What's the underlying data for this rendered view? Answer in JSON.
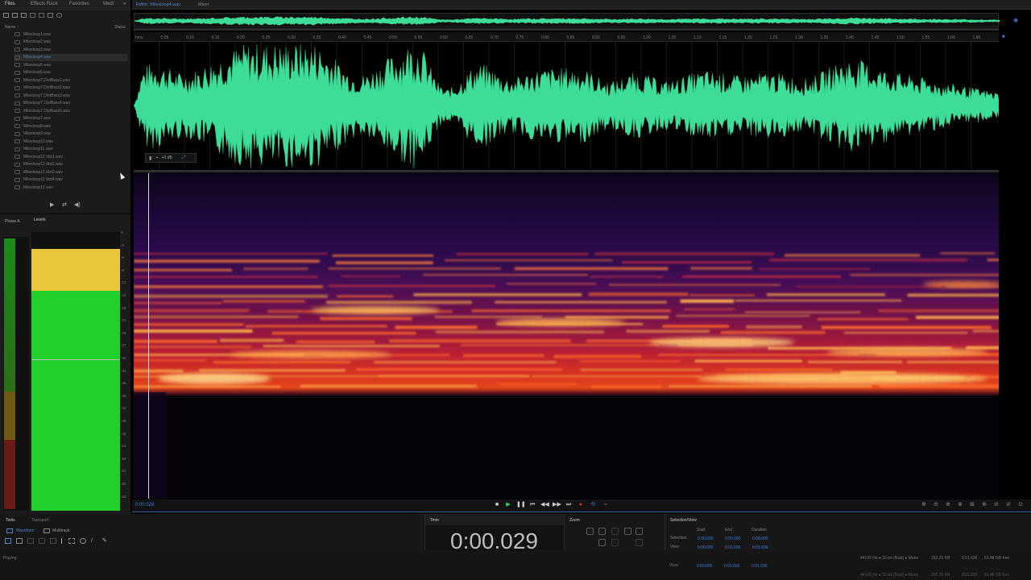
{
  "left_tabs": [
    "Files",
    "Effects Rack",
    "Favorites",
    "Medi"
  ],
  "files_header": {
    "name": "Name ↑",
    "status": "Status"
  },
  "files": [
    "Milesloop1.wav",
    "Milesloop2.wav",
    "Milesloop3.wav",
    "Milesloop4.wav",
    "Milesloop5.wav",
    "Milesloop6.wav",
    "Milesloop7 DistBass1.wav",
    "Milesloop7 DistBass2.wav",
    "Milesloop7 DistBass3.wav",
    "Milesloop7 DistBass4.wav",
    "Milesloop7 DistBass5.wav",
    "Milesloop7.wav",
    "Milesloop8.wav",
    "Milesloop9.wav",
    "Milesloop10.wav",
    "Milesloop11.wav",
    "Milesloop12 dist1.wav",
    "Milesloop12 dist2.wav",
    "Milesloop12 dist3.wav",
    "Milesloop12 dist4.wav",
    "Milesloop12.wav"
  ],
  "selected_file_index": 3,
  "meter_tabs": {
    "phase": "Phase A",
    "levels": "Levels"
  },
  "editor_tabs": {
    "editor": "Editor: Milesloop4.wav",
    "mixer": "Mixer"
  },
  "ruler_labels": [
    "hms",
    "0.05",
    "0.10",
    "0.15",
    "0.20",
    "0.25",
    "0.30",
    "0.35",
    "0.40",
    "0.45",
    "0.50",
    "0.55",
    "0.60",
    "0.65",
    "0.70",
    "0.75",
    "0.80",
    "0.85",
    "0.90",
    "0.95",
    "1.00",
    "1.05",
    "1.10",
    "1.15",
    "1.20",
    "1.25",
    "1.30",
    "1.35",
    "1.40",
    "1.45",
    "1.50",
    "1.55",
    "1.60",
    "1.65"
  ],
  "hud_gain": "+0 dB",
  "current_time_small": "0:00.029",
  "levels_scale": [
    "0",
    "-3",
    "-6",
    "-9",
    "-12",
    "-15",
    "-18",
    "-21",
    "-24",
    "-27",
    "-30",
    "-33",
    "-36",
    "-39",
    "-42",
    "-45",
    "-48",
    "-51",
    "-54",
    "-57",
    "-60",
    "-63"
  ],
  "bottom_tabs": {
    "tools": "Tools",
    "transport": "Transport",
    "waveform": "Waveform",
    "multitrack": "Multitrack"
  },
  "time_panel": {
    "title": "Time",
    "value": "0:00.029"
  },
  "zoom_panel": {
    "title": "Zoom"
  },
  "selection_panel": {
    "title": "Selection/View",
    "headers": [
      "Start",
      "End",
      "Duration"
    ],
    "rows": [
      {
        "label": "Selection",
        "start": "0:00.000",
        "end": "0:00.000",
        "duration": "0:00.000"
      },
      {
        "label": "View",
        "start": "0:00.000",
        "end": "0:01.696",
        "duration": "0:01.696"
      }
    ]
  },
  "status": {
    "left": "Playing",
    "format": "44100 Hz ● 32-bit (float) ● Mono",
    "size": "292.26 KB",
    "duration": "0:01.696",
    "free": "51.48 GB free"
  },
  "colors": {
    "waveform": "#3ddc97",
    "accent": "#2f6fd6",
    "meter_yellow": "#e8c73a",
    "meter_green": "#1fd12a"
  },
  "meter_levels": {
    "peak_db": -2,
    "rms_db": -6
  }
}
